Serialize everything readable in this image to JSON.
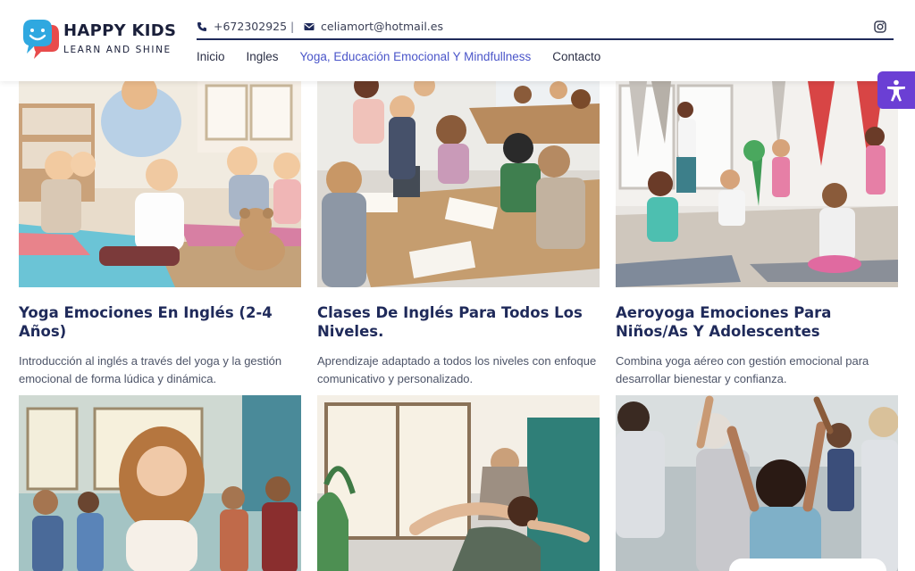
{
  "brand": {
    "name": "HAPPY KIDS",
    "tagline": "LEARN AND SHINE",
    "logo_icon": "smiley-speech-bubble-icon",
    "colors": {
      "primary": "#1f2a5a",
      "accent": "#4a55c9",
      "logo_blue": "#2fa8e0",
      "logo_red": "#e84b4b",
      "a11y_purple": "#6b3fd4"
    }
  },
  "contact": {
    "phone_icon": "phone-icon",
    "phone": "+672302925",
    "separator": "|",
    "email_icon": "mail-icon",
    "email": "celiamort@hotmail.es",
    "social_icon": "instagram-icon"
  },
  "nav": {
    "items": [
      {
        "label": "Inicio"
      },
      {
        "label": "Ingles"
      },
      {
        "label": "Yoga, Educación Emocional Y Mindfullness"
      },
      {
        "label": "Contacto"
      }
    ],
    "active_index": 2
  },
  "accessibility_button": {
    "icon": "accessibility-person-icon"
  },
  "cards": [
    {
      "title": "Yoga Emociones En Inglés (2-4 Años)",
      "description": "Introducción al inglés a través del yoga y la gestión emocional de forma lúdica y dinámica.",
      "image": "toddlers-yoga-class-with-teddy-bear"
    },
    {
      "title": "Clases De Inglés Para Todos Los Niveles.",
      "description": "Aprendizaje adaptado a todos los niveles con enfoque comunicativo y personalizado.",
      "image": "students-studying-english-at-table"
    },
    {
      "title": "Aeroyoga Emociones Para Niños/As Y Adolescentes",
      "description": "Combina yoga aéreo con gestión emocional para desarrollar bienestar y confianza.",
      "image": "kids-aerial-yoga-studio"
    }
  ],
  "cards_row2": [
    {
      "image": "teen-girl-meditating"
    },
    {
      "image": "adults-partner-yoga"
    },
    {
      "image": "group-dance-movement-class"
    }
  ]
}
